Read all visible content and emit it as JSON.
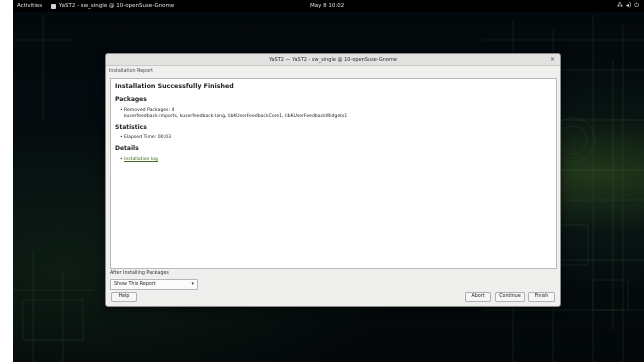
{
  "topbar": {
    "activities": "Activities",
    "app_name": "YaST2 - sw_single @ 10-openSuse-Gnome",
    "clock": "May 8  10:02",
    "tray_icons": [
      "network-icon",
      "volume-icon",
      "power-icon"
    ]
  },
  "dialog": {
    "title": "YaST2 — YaST2 - sw_single @ 10-openSuse-Gnome",
    "subheader": "Installation Report",
    "heading": "Installation Successfully Finished",
    "packages": {
      "title": "Packages",
      "removed": "Removed Packages: 4",
      "removed_list": "kuserfeedback-imports, kuserfeedback-lang, libKUserFeedbackCore1, libKUserFeedbackWidgets1"
    },
    "statistics": {
      "title": "Statistics",
      "elapsed": "Elapsed Time: 00:03"
    },
    "details": {
      "title": "Details",
      "log_link": "Installation log"
    },
    "after_label": "After Installing Packages",
    "after_value": "Show This Report",
    "buttons": {
      "help": "Help",
      "abort": "Abort",
      "continue": "Continue",
      "finish": "Finish"
    }
  },
  "colors": {
    "link": "#3b6c1f",
    "topbar": "#000000",
    "dialog_bg": "#efefee"
  }
}
